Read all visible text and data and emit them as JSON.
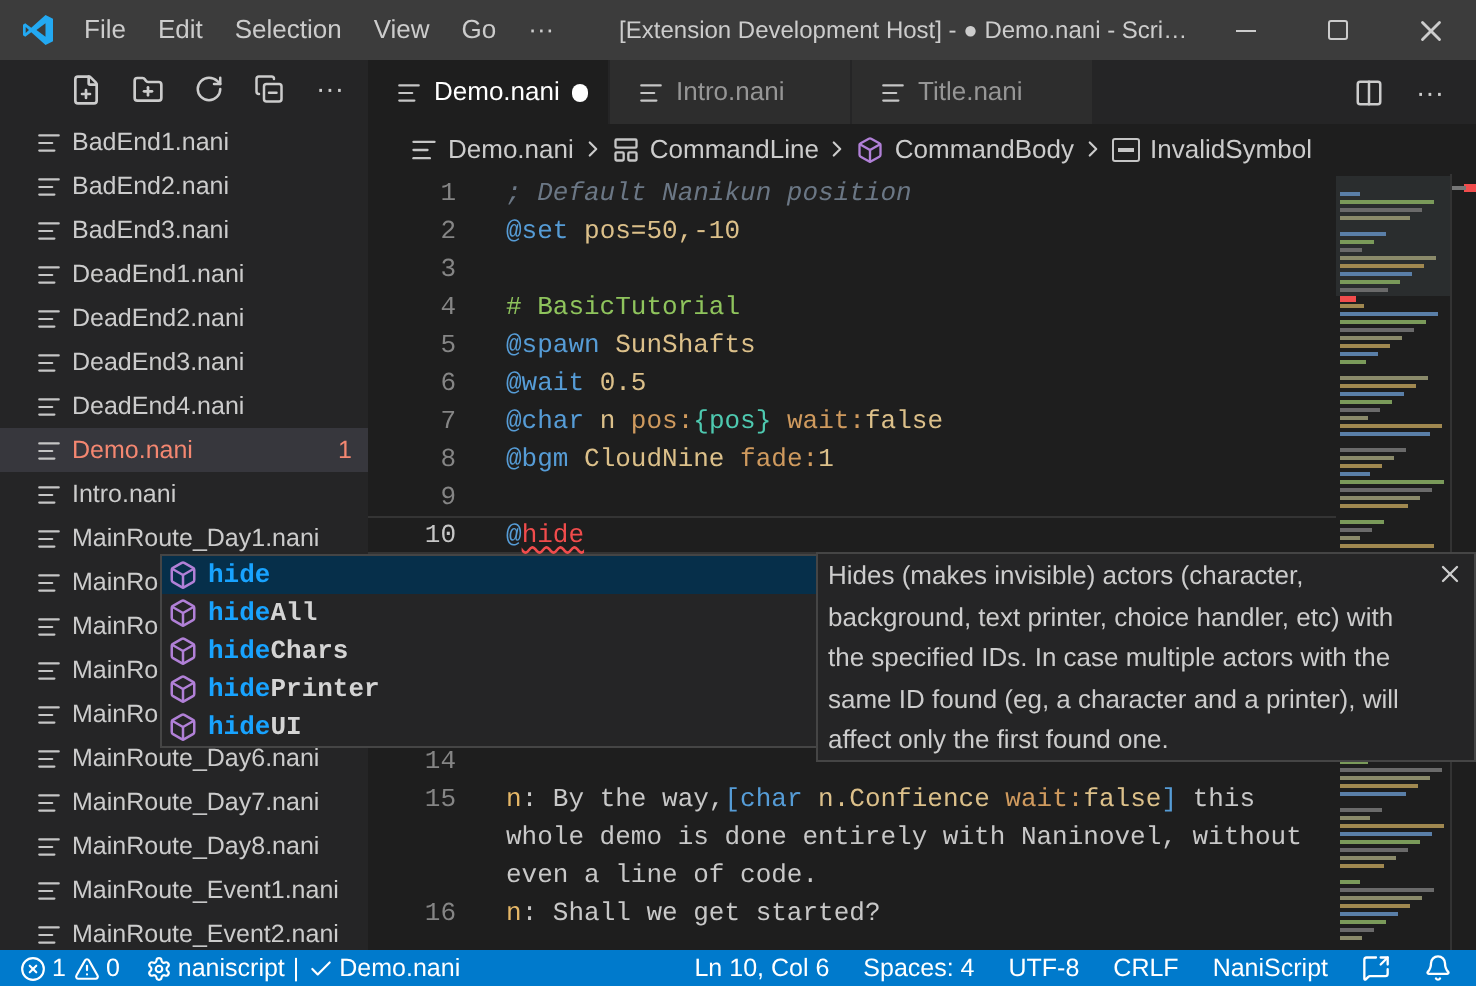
{
  "title_bar": {
    "menu": [
      "File",
      "Edit",
      "Selection",
      "View",
      "Go",
      "···"
    ],
    "title": "[Extension Development Host] - ● Demo.nani - Scri…"
  },
  "explorer": {
    "more": "···",
    "files": [
      {
        "name": "BadEnd1.nani",
        "selected": false,
        "error": false
      },
      {
        "name": "BadEnd2.nani",
        "selected": false,
        "error": false
      },
      {
        "name": "BadEnd3.nani",
        "selected": false,
        "error": false
      },
      {
        "name": "DeadEnd1.nani",
        "selected": false,
        "error": false
      },
      {
        "name": "DeadEnd2.nani",
        "selected": false,
        "error": false
      },
      {
        "name": "DeadEnd3.nani",
        "selected": false,
        "error": false
      },
      {
        "name": "DeadEnd4.nani",
        "selected": false,
        "error": false
      },
      {
        "name": "Demo.nani",
        "selected": true,
        "error": true,
        "badge": "1"
      },
      {
        "name": "Intro.nani",
        "selected": false,
        "error": false
      },
      {
        "name": "MainRoute_Day1.nani",
        "selected": false,
        "error": false
      },
      {
        "name": "MainRo",
        "selected": false,
        "error": false
      },
      {
        "name": "MainRo",
        "selected": false,
        "error": false
      },
      {
        "name": "MainRo",
        "selected": false,
        "error": false
      },
      {
        "name": "MainRo",
        "selected": false,
        "error": false
      },
      {
        "name": "MainRoute_Day6.nani",
        "selected": false,
        "error": false
      },
      {
        "name": "MainRoute_Day7.nani",
        "selected": false,
        "error": false
      },
      {
        "name": "MainRoute_Day8.nani",
        "selected": false,
        "error": false
      },
      {
        "name": "MainRoute_Event1.nani",
        "selected": false,
        "error": false
      },
      {
        "name": "MainRoute_Event2.nani",
        "selected": false,
        "error": false
      }
    ]
  },
  "tabs": [
    {
      "label": "Demo.nani",
      "selected": true,
      "dirty": true
    },
    {
      "label": "Intro.nani",
      "selected": false,
      "dirty": false
    },
    {
      "label": "Title.nani",
      "selected": false,
      "dirty": false
    }
  ],
  "tab_actions": {
    "more": "···"
  },
  "breadcrumb": [
    {
      "label": "Demo.nani",
      "kind": "file"
    },
    {
      "label": "CommandLine",
      "kind": "struct"
    },
    {
      "label": "CommandBody",
      "kind": "cube"
    },
    {
      "label": "InvalidSymbol",
      "kind": "symbol"
    }
  ],
  "code": {
    "lines_top": [
      {
        "number": "1",
        "current": false,
        "rows": [
          [
            {
              "text": "; Default Nanikun position",
              "kind": "comment"
            }
          ]
        ]
      },
      {
        "number": "2",
        "current": false,
        "rows": [
          [
            {
              "text": "@set",
              "kind": "command"
            },
            {
              "text": " pos=50,-10",
              "kind": "value"
            }
          ]
        ]
      },
      {
        "number": "3",
        "current": false
      },
      {
        "number": "4",
        "current": false,
        "rows": [
          [
            {
              "text": "# BasicTutorial",
              "kind": "label"
            }
          ]
        ]
      },
      {
        "number": "5",
        "current": false,
        "rows": [
          [
            {
              "text": "@spawn",
              "kind": "command"
            },
            {
              "text": " SunShafts",
              "kind": "value"
            }
          ]
        ]
      },
      {
        "number": "6",
        "current": false,
        "rows": [
          [
            {
              "text": "@wait",
              "kind": "command"
            },
            {
              "text": " 0.5",
              "kind": "value"
            }
          ]
        ]
      },
      {
        "number": "7",
        "current": false,
        "rows": [
          [
            {
              "text": "@char",
              "kind": "command"
            },
            {
              "text": " n ",
              "kind": "value"
            },
            {
              "text": "pos:",
              "kind": "param"
            },
            {
              "text": "{pos}",
              "kind": "expression"
            },
            {
              "text": " ",
              "kind": "text"
            },
            {
              "text": "wait:",
              "kind": "param"
            },
            {
              "text": "false",
              "kind": "value"
            }
          ]
        ]
      },
      {
        "number": "8",
        "current": false,
        "rows": [
          [
            {
              "text": "@bgm",
              "kind": "command"
            },
            {
              "text": " CloudNine ",
              "kind": "value"
            },
            {
              "text": "fade:",
              "kind": "param"
            },
            {
              "text": "1",
              "kind": "value"
            }
          ]
        ]
      },
      {
        "number": "9",
        "current": false
      },
      {
        "number": "10",
        "current": true,
        "rows": [
          [
            {
              "text": "@",
              "kind": "command"
            },
            {
              "text": "hide",
              "kind": "error"
            }
          ]
        ]
      }
    ],
    "lines_bottom": [
      {
        "number": "14",
        "current": false
      },
      {
        "number": "15",
        "current": false,
        "rows": [
          [
            {
              "text": "n",
              "kind": "author"
            },
            {
              "text": ": By the way,",
              "kind": "text"
            },
            {
              "text": "[char",
              "kind": "command"
            },
            {
              "text": " n.Confience ",
              "kind": "value"
            },
            {
              "text": "wait:",
              "kind": "param"
            },
            {
              "text": "false",
              "kind": "value"
            },
            {
              "text": "]",
              "kind": "command"
            },
            {
              "text": " this",
              "kind": "text"
            }
          ],
          [
            {
              "text": "whole demo is done entirely with Naninovel, without",
              "kind": "text"
            }
          ],
          [
            {
              "text": "even a line of code.",
              "kind": "text"
            }
          ]
        ]
      },
      {
        "number": "16",
        "current": false,
        "rows": [
          [
            {
              "text": "n",
              "kind": "author"
            },
            {
              "text": ": Shall we get started?",
              "kind": "text"
            }
          ]
        ]
      }
    ]
  },
  "suggestions": [
    {
      "match": "hide",
      "selected": true
    },
    {
      "match": "hide",
      "rest": "All",
      "selected": false
    },
    {
      "match": "hide",
      "rest": "Chars",
      "selected": false
    },
    {
      "match": "hide",
      "rest": "Printer",
      "selected": false
    },
    {
      "match": "hide",
      "rest": "UI",
      "selected": false
    }
  ],
  "details": {
    "text": "Hides (makes invisible) actors (character, background, text printer, choice handler, etc) with the specified IDs. In case multiple actors with the same ID found (eg, a character and a printer), will affect only the first found one."
  },
  "status_bar": {
    "left": [
      {
        "kind": "errors",
        "text": "1"
      },
      {
        "kind": "warnings",
        "text": "0"
      },
      {
        "kind": "gear",
        "text": "naniscript"
      },
      {
        "kind": "plain",
        "text": "|"
      },
      {
        "kind": "check",
        "text": "Demo.nani"
      }
    ],
    "right": [
      "Ln 10, Col 6",
      "Spaces: 4",
      "UTF-8",
      "CRLF",
      "NaniScript"
    ]
  }
}
